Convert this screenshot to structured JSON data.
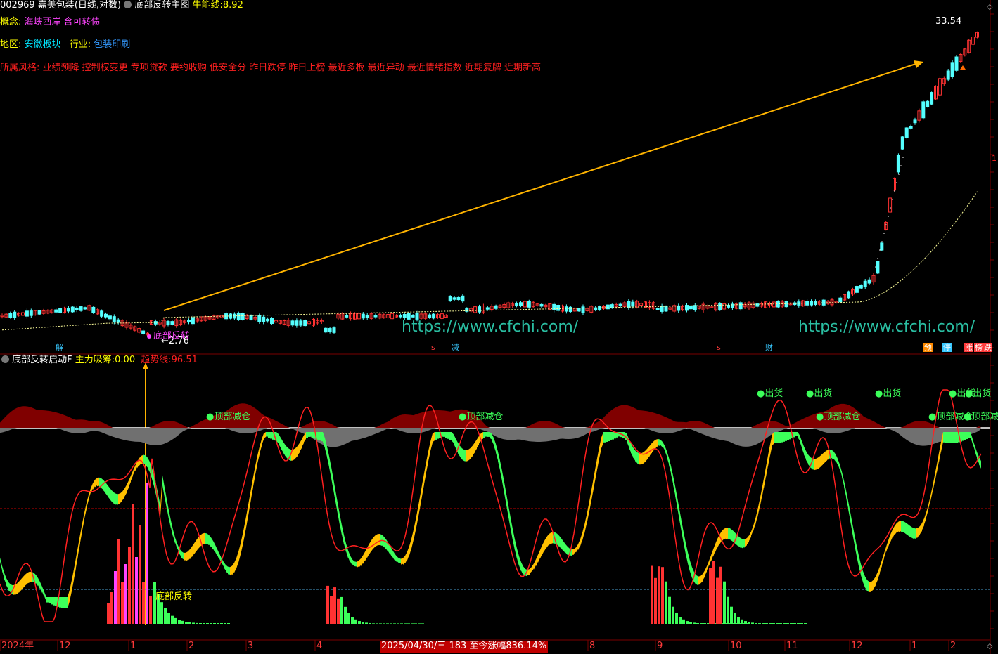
{
  "header": {
    "code": "002969",
    "name": "嘉美包装",
    "period": "(日线,对数)",
    "indicator": "底部反转主图",
    "niu_label": "牛能线:",
    "niu_value": "8.92"
  },
  "info": {
    "concept_label": "概念:",
    "concepts": "海峡西岸 含可转债",
    "region_label": "地区:",
    "region": "安徽板块",
    "industry_label": "行业:",
    "industry": "包装印刷",
    "style_label": "所属风格:",
    "styles": "业绩预降 控制权变更 专项贷款 要约收购 低安全分 昨日跌停 昨日上榜 最近多板 最近异动 最近情绪指数 近期复牌 近期新高"
  },
  "price_pane": {
    "high_label": "33.54",
    "low_label": "2.76",
    "bottom_signal": "底部反转",
    "watermark": "https://www.cfchi.com/",
    "right_marker": "1"
  },
  "event_markers": [
    "解",
    "s",
    "减",
    "s",
    "财",
    "预",
    "停",
    "涨",
    "榜",
    "跌"
  ],
  "indicator_pane": {
    "title": "底部反转启动F",
    "main_label": "主力吸筹:",
    "main_value": "0.00",
    "trend_label": "趋势线:",
    "trend_value": "96.51",
    "signal_bottom": "底部反转",
    "signals": [
      "顶部减仓",
      "顶部减仓",
      "出货",
      "出货",
      "顶部减仓",
      "出货",
      "出货",
      "出货",
      "顶部减仓",
      "顶部减仓"
    ]
  },
  "time_axis": {
    "labels": [
      "2024年",
      "12",
      "1",
      "2",
      "3",
      "4",
      "8",
      "9",
      "10",
      "11",
      "12",
      "1",
      "2"
    ],
    "cursor_info": "2025/04/30/三 183 至今涨幅836.14%"
  },
  "colors": {
    "up": "#ff3232",
    "down": "#54ffff",
    "arrow": "#ffb400",
    "ma": "#ffff9c",
    "red_line": "#ff2020",
    "yellow_band": "#ffc000",
    "green_band": "#3cff5a",
    "dark_red": "#800000"
  },
  "chart_data": {
    "type": "candlestick",
    "series": [
      {
        "name": "牛能线",
        "values": [
          8.92
        ]
      },
      {
        "name": "主力吸筹",
        "values": [
          0.0
        ]
      },
      {
        "name": "趋势线",
        "values": [
          96.51
        ]
      }
    ],
    "price_range": [
      2.76,
      33.54
    ],
    "gain_since": "836.14%"
  }
}
